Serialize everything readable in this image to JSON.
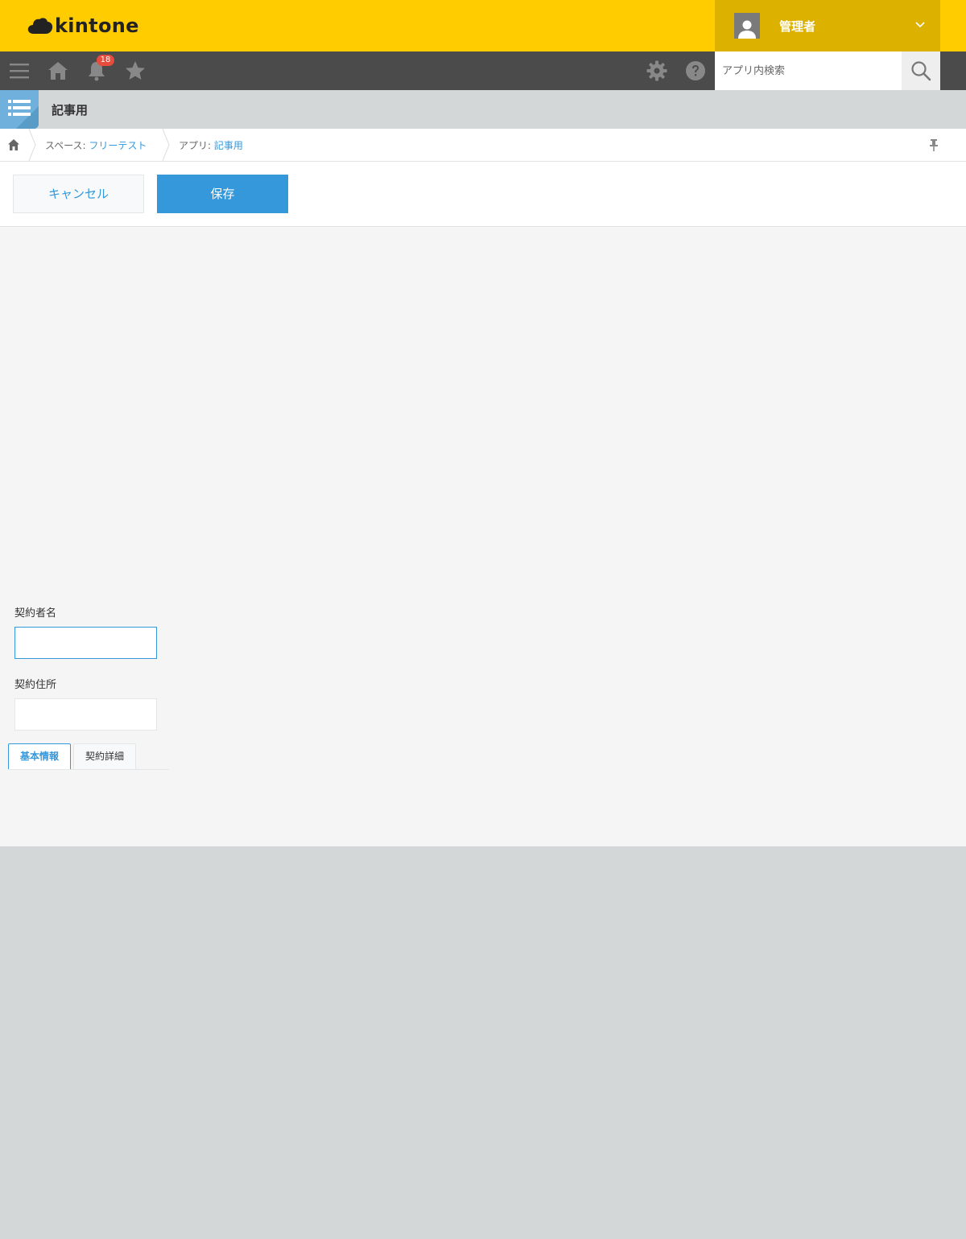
{
  "header": {
    "logo_text": "kintone",
    "user_name": "管理者",
    "brand_color": "#ffcc00"
  },
  "toolbar": {
    "icons": [
      "menu-icon",
      "home-icon",
      "bell-icon",
      "star-icon",
      "gear-icon",
      "help-icon",
      "search-icon"
    ],
    "notification_count": "18",
    "search_placeholder": "アプリ内検索"
  },
  "app": {
    "title": "記事用"
  },
  "breadcrumb": {
    "space_prefix": "スペース: ",
    "space_name": "フリーテスト",
    "app_prefix": "アプリ: ",
    "app_name": "記事用"
  },
  "actions": {
    "cancel_label": "キャンセル",
    "save_label": "保存",
    "accent_color": "#3498db"
  },
  "form": {
    "fields": [
      {
        "label": "契約者名",
        "value": ""
      },
      {
        "label": "契約住所",
        "value": ""
      }
    ],
    "tabs": [
      {
        "label": "基本情報",
        "active": true
      },
      {
        "label": "契約詳細",
        "active": false
      }
    ]
  }
}
